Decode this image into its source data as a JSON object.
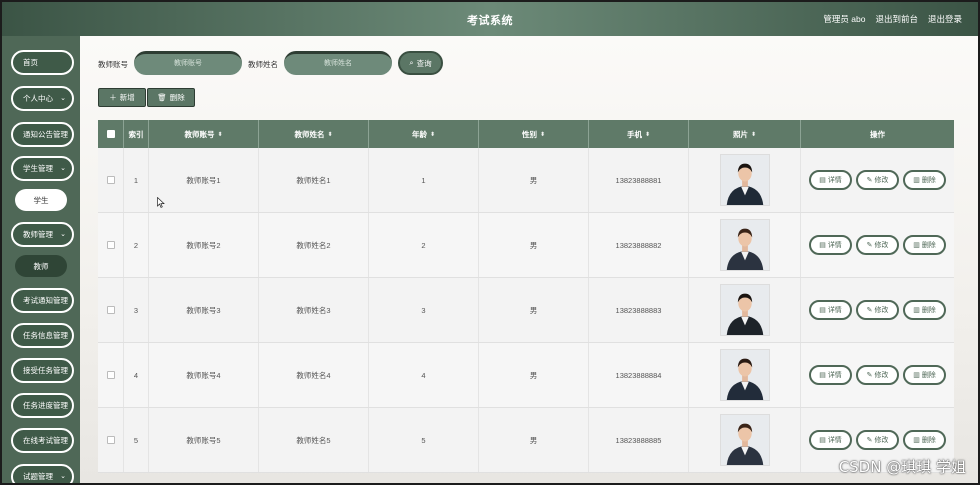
{
  "header": {
    "title": "考试系统",
    "user": "管理员 abo",
    "front_link": "退出到前台",
    "logout_link": "退出登录"
  },
  "sidebar": {
    "items": [
      {
        "label": "首页",
        "has_chevron": false
      },
      {
        "label": "个人中心",
        "has_chevron": true
      },
      {
        "label": "通知公告管理",
        "has_chevron": false
      },
      {
        "label": "学生管理",
        "has_chevron": true
      },
      {
        "label": "学生",
        "sub": "light"
      },
      {
        "label": "教师管理",
        "has_chevron": true
      },
      {
        "label": "教师",
        "sub": "dark"
      },
      {
        "label": "考试通知管理",
        "has_chevron": false
      },
      {
        "label": "任务信息管理",
        "has_chevron": false
      },
      {
        "label": "接受任务管理",
        "has_chevron": false
      },
      {
        "label": "任务进度管理",
        "has_chevron": false
      },
      {
        "label": "在线考试管理",
        "has_chevron": false
      },
      {
        "label": "试题管理",
        "has_chevron": true
      }
    ]
  },
  "search": {
    "account_label": "教师账号",
    "account_placeholder": "教师账号",
    "name_label": "教师姓名",
    "name_placeholder": "教师姓名",
    "search_button": "查询"
  },
  "toolbar": {
    "add_button": "新增",
    "delete_button": "删除"
  },
  "table": {
    "columns": [
      "索引",
      "教师账号",
      "教师姓名",
      "年龄",
      "性别",
      "手机",
      "照片",
      "操作"
    ],
    "rows": [
      {
        "index": "1",
        "account": "教师账号1",
        "name": "教师姓名1",
        "age": "1",
        "gender": "男",
        "phone": "13823888881"
      },
      {
        "index": "2",
        "account": "教师账号2",
        "name": "教师姓名2",
        "age": "2",
        "gender": "男",
        "phone": "13823888882"
      },
      {
        "index": "3",
        "account": "教师账号3",
        "name": "教师姓名3",
        "age": "3",
        "gender": "男",
        "phone": "13823888883"
      },
      {
        "index": "4",
        "account": "教师账号4",
        "name": "教师姓名4",
        "age": "4",
        "gender": "男",
        "phone": "13823888884"
      },
      {
        "index": "5",
        "account": "教师账号5",
        "name": "教师姓名5",
        "age": "5",
        "gender": "男",
        "phone": "13823888885"
      }
    ],
    "actions": {
      "detail": "详情",
      "edit": "修改",
      "delete": "删除"
    }
  },
  "watermark": "CSDN @琪琪 学姐",
  "colors": {
    "primary": "#4f6857",
    "header": "#5f7a68",
    "accent": "#3b5445"
  }
}
